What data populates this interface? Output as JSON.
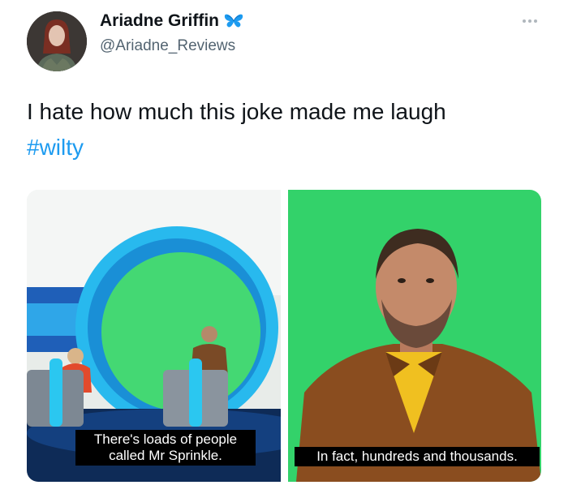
{
  "tweet": {
    "display_name": "Ariadne Griffin",
    "handle": "@Ariadne_Reviews",
    "badge_icon": "butterfly-icon",
    "more_icon": "more-options-icon",
    "text": "I hate how much this joke made me laugh",
    "hashtag": "#wilty"
  },
  "media": {
    "left_caption_line1": "There's loads of people",
    "left_caption_line2": "called Mr Sprinkle.",
    "right_caption": "In fact, hundreds and thousands."
  },
  "colors": {
    "text": "#0f1419",
    "handle": "#536471",
    "hashtag": "#1d9bf0",
    "butterfly": "#1d9bf0",
    "green_screen": "#33d26a"
  }
}
